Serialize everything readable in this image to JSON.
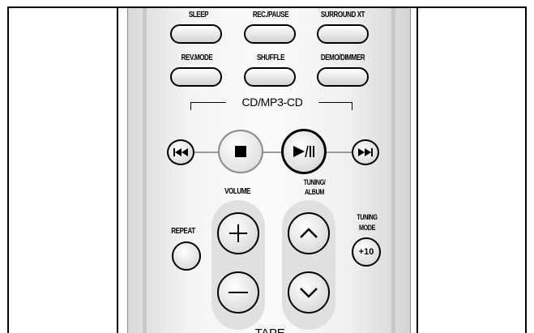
{
  "remote": {
    "top_row": [
      {
        "label": "SLEEP"
      },
      {
        "label": "REC./PAUSE"
      },
      {
        "label": "SURROUND XT"
      }
    ],
    "second_row": [
      {
        "label": "REV.MODE"
      },
      {
        "label": "SHUFFLE"
      },
      {
        "label": "DEMO/DIMMER"
      }
    ],
    "cd_section": {
      "title": "CD/MP3-CD"
    },
    "volume": {
      "label": "VOLUME"
    },
    "tuning_album": {
      "label_line1": "TUNING/",
      "label_line2": "ALBUM"
    },
    "repeat": {
      "label": "REPEAT"
    },
    "tuning_mode": {
      "label_line1": "TUNING",
      "label_line2": "MODE",
      "plus10": "+10"
    },
    "bottom_section": {
      "title": "TAPE"
    }
  },
  "icons": [
    "prev-track-icon",
    "stop-icon",
    "play-pause-icon",
    "next-track-icon",
    "plus-icon",
    "minus-icon",
    "up-chevron-icon",
    "down-chevron-icon",
    "pointer-arrow-icon"
  ]
}
